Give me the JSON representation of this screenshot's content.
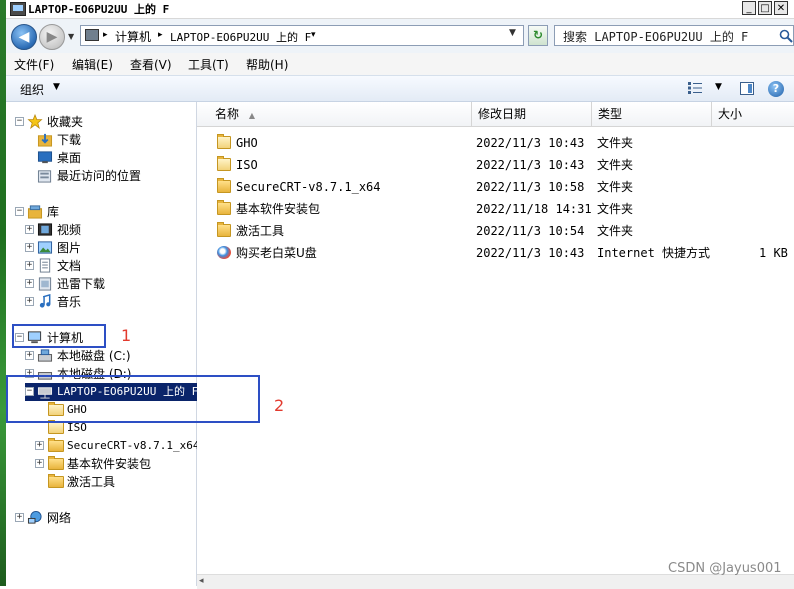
{
  "window": {
    "title": "LAPTOP-EO6PU2UU 上的 F"
  },
  "title_buttons": {
    "minimize": "_",
    "maximize": "□",
    "close": "✕"
  },
  "address_bar": {
    "back_glyph": "◀",
    "forward_glyph": "▶",
    "segments": [
      "计算机",
      "LAPTOP-EO6PU2UU 上的 F"
    ],
    "separator": "▸",
    "refresh_glyph": "↻"
  },
  "search": {
    "placeholder": "搜索 LAPTOP-EO6PU2UU 上的 F"
  },
  "menu": [
    "文件(F)",
    "编辑(E)",
    "查看(V)",
    "工具(T)",
    "帮助(H)"
  ],
  "toolbar": {
    "organize": "组织",
    "help": "?"
  },
  "nav_tree": {
    "favorites": {
      "label": "收藏夹",
      "items": [
        "下载",
        "桌面",
        "最近访问的位置"
      ]
    },
    "libraries": {
      "label": "库",
      "items": [
        "视频",
        "图片",
        "文档",
        "迅雷下载",
        "音乐"
      ]
    },
    "computer": {
      "label": "计算机",
      "drives": [
        "本地磁盘 (C:)",
        "本地磁盘 (D:)"
      ],
      "network_drive": "LAPTOP-EO6PU2UU 上的 F",
      "subfolders": [
        "GHO",
        "ISO",
        "SecureCRT-v8.7.1_x64",
        "基本软件安装包",
        "激活工具"
      ]
    },
    "network": {
      "label": "网络"
    }
  },
  "columns": {
    "name": "名称",
    "date": "修改日期",
    "type": "类型",
    "size": "大小"
  },
  "files": [
    {
      "name": "GHO",
      "date": "2022/11/3 10:43",
      "type": "文件夹",
      "size": ""
    },
    {
      "name": "ISO",
      "date": "2022/11/3 10:43",
      "type": "文件夹",
      "size": ""
    },
    {
      "name": "SecureCRT-v8.7.1_x64",
      "date": "2022/11/3 10:58",
      "type": "文件夹",
      "size": ""
    },
    {
      "name": "基本软件安装包",
      "date": "2022/11/18 14:31",
      "type": "文件夹",
      "size": ""
    },
    {
      "name": "激活工具",
      "date": "2022/11/3 10:54",
      "type": "文件夹",
      "size": ""
    },
    {
      "name": "购买老白菜U盘",
      "date": "2022/11/3 10:43",
      "type": "Internet 快捷方式",
      "size": "1 KB"
    }
  ],
  "annotations": {
    "label_1": "1",
    "label_2": "2",
    "box_color": "#2d4fc4",
    "number_color": "#e23a2e"
  },
  "watermark": "CSDN @Jayus001",
  "colors": {
    "selection": "#0a246a",
    "folder": "#e8b43c"
  }
}
